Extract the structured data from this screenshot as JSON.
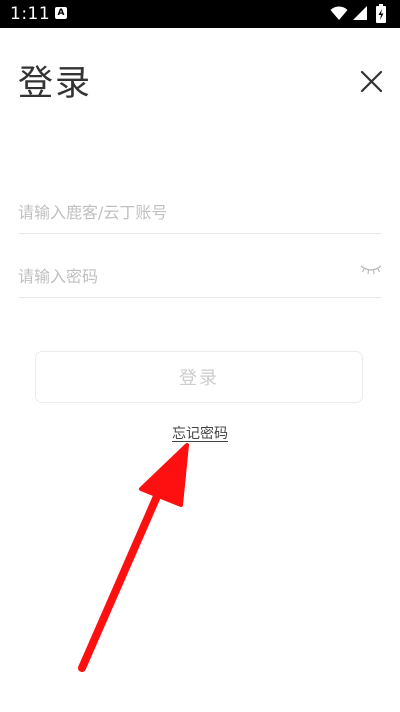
{
  "status_bar": {
    "time": "1:11",
    "notification_icon": "A"
  },
  "header": {
    "title": "登录",
    "close_icon": "close-icon"
  },
  "form": {
    "account_placeholder": "请输入鹿客/云丁账号",
    "password_placeholder": "请输入密码",
    "login_label": "登录",
    "forgot_label": "忘记密码"
  },
  "colors": {
    "annotation_arrow": "#ff1010",
    "title": "#333333",
    "placeholder": "#c0c0c0"
  }
}
